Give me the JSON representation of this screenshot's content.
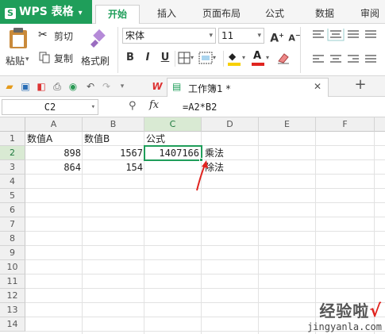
{
  "app": {
    "brand": "WPS 表格",
    "logo_letter": "S"
  },
  "menu": {
    "tabs": [
      "开始",
      "插入",
      "页面布局",
      "公式",
      "数据",
      "审阅"
    ],
    "active": "开始"
  },
  "ribbon": {
    "cut": "剪切",
    "paste": "粘贴",
    "copy": "复制",
    "format_painter": "格式刷",
    "font_name": "宋体",
    "font_size": "11",
    "bold": "B",
    "italic": "I",
    "underline": "U",
    "grow_font": "A",
    "shrink_font": "A"
  },
  "doc_tab": {
    "title": "工作簿1 *"
  },
  "formula_bar": {
    "name_box": "C2",
    "fx": "fx",
    "formula": "=A2*B2"
  },
  "sheet": {
    "columns": [
      "A",
      "B",
      "C",
      "D",
      "E",
      "F"
    ],
    "rows": [
      "1",
      "2",
      "3",
      "4",
      "5",
      "6",
      "7",
      "8",
      "9",
      "10",
      "11",
      "12",
      "13",
      "14"
    ],
    "cells": {
      "A1": "数值A",
      "B1": "数值B",
      "C1": "公式",
      "A2": "898",
      "B2": "1567",
      "C2": "1407166",
      "D2": "乘法",
      "A3": "864",
      "B3": "154",
      "D3": "除法"
    }
  },
  "watermark": {
    "title": "经验啦",
    "check": "√",
    "url": "jingyanla.com"
  },
  "colors": {
    "brand_green": "#1f9e5a",
    "arrow_red": "#e0241f"
  }
}
